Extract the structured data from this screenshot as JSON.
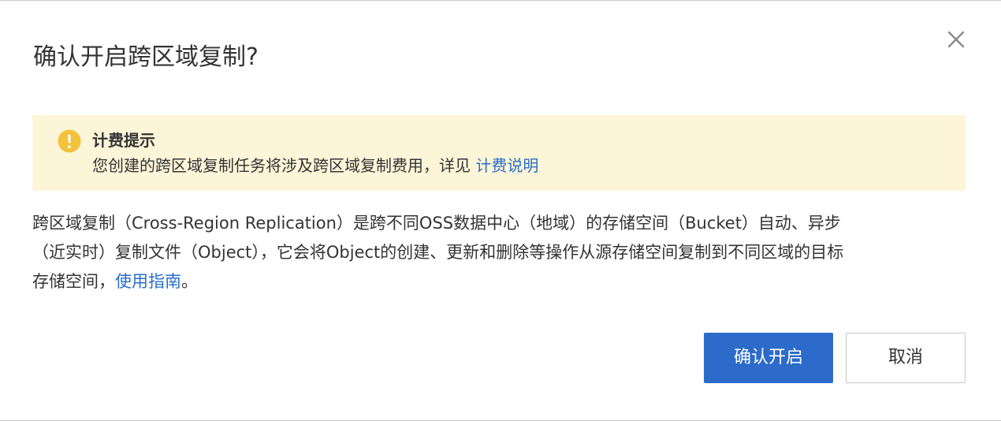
{
  "dialog": {
    "title": "确认开启跨区域复制?",
    "close_icon": "close-icon"
  },
  "notice": {
    "icon": "warning-icon",
    "icon_color": "#f2c23a",
    "background": "#fdf5d8",
    "title": "计费提示",
    "text": "您创建的跨区域复制任务将涉及跨区域复制费用，详见 ",
    "link_label": "计费说明"
  },
  "description": {
    "line1": "跨区域复制（Cross-Region Replication）是跨不同OSS数据中心（地域）的存储空间（Bucket）自动、异步",
    "line2": "（近实时）复制文件（Object），它会将Object的创建、更新和删除等操作从源存储空间复制到不同区域的目标",
    "line3_prefix": "存储空间，",
    "guide_link": "使用指南",
    "line3_suffix": "。"
  },
  "buttons": {
    "confirm_label": "确认开启",
    "cancel_label": "取消"
  },
  "colors": {
    "primary": "#2c6bc9",
    "link": "#2a6ec8"
  }
}
